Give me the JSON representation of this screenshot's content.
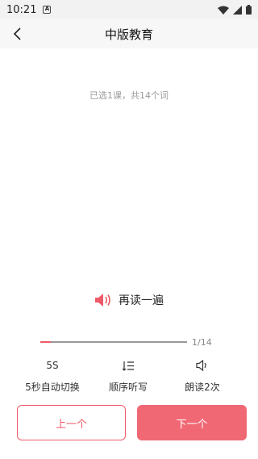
{
  "status_bar": {
    "time": "10:21",
    "notification_glyph": "A"
  },
  "header": {
    "title": "中版教育"
  },
  "info": {
    "selected_text": "已选1课，共14个词"
  },
  "reread": {
    "label": "再读一遍",
    "icon_color": "#ee5a67"
  },
  "progress": {
    "current": 1,
    "total": 14,
    "text": "1/14"
  },
  "controls": {
    "auto_switch": {
      "value": "5S",
      "label": "5秒自动切换"
    },
    "order": {
      "label": "顺序听写"
    },
    "read_times": {
      "label": "朗读2次"
    }
  },
  "buttons": {
    "prev_label": "上一个",
    "next_label": "下一个"
  },
  "colors": {
    "accent": "#ee5a67",
    "next_button": "#f06874"
  }
}
